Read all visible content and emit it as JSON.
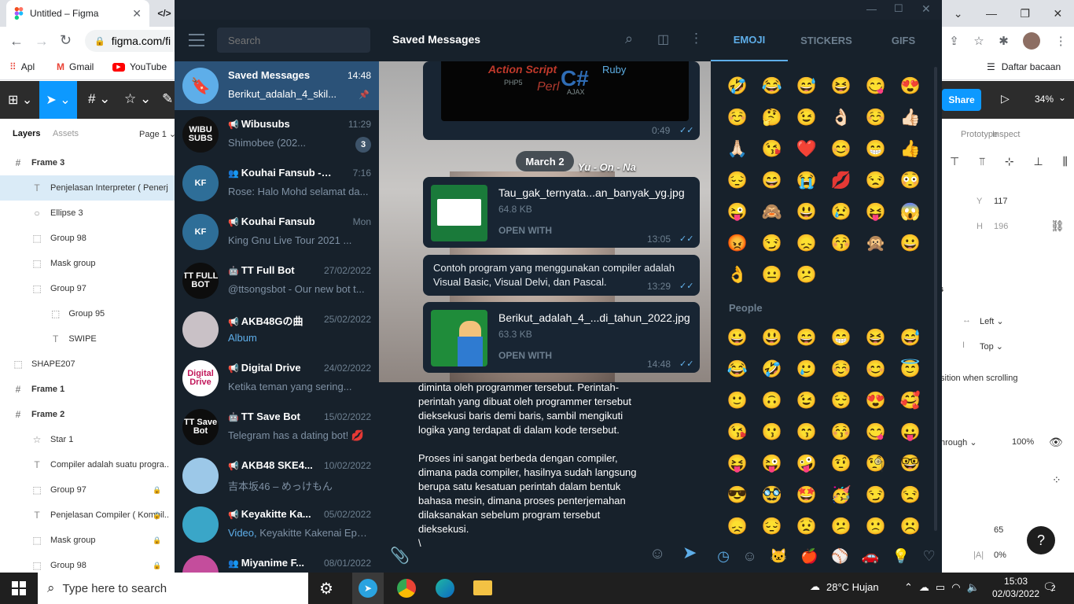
{
  "chrome": {
    "tab_title": "Untitled – Figma",
    "url": "figma.com/fi",
    "bookmarks": [
      "Apl",
      "Gmail",
      "YouTube"
    ],
    "reading_list": "Daftar bacaan"
  },
  "figma": {
    "layers_tab": "Layers",
    "assets_tab": "Assets",
    "page": "Page 1",
    "layers": [
      {
        "icon": "#",
        "name": "Frame 3",
        "indent": 0,
        "frame": true
      },
      {
        "icon": "T",
        "name": "Penjelasan Interpreter ( Penerj",
        "indent": 1,
        "selected": true
      },
      {
        "icon": "○",
        "name": "Ellipse 3",
        "indent": 1
      },
      {
        "icon": "⬚",
        "name": "Group 98",
        "indent": 1
      },
      {
        "icon": "⬚",
        "name": "Mask group",
        "indent": 1
      },
      {
        "icon": "⬚",
        "name": "Group 97",
        "indent": 1
      },
      {
        "icon": "⬚",
        "name": "Group 95",
        "indent": 2
      },
      {
        "icon": "T",
        "name": "SWIPE",
        "indent": 2
      },
      {
        "icon": "⬚",
        "name": "SHAPE207",
        "indent": 0
      },
      {
        "icon": "#",
        "name": "Frame 1",
        "indent": 0,
        "frame": true
      },
      {
        "icon": "#",
        "name": "Frame 2",
        "indent": 0,
        "frame": true
      },
      {
        "icon": "☆",
        "name": "Star 1",
        "indent": 1
      },
      {
        "icon": "T",
        "name": "Compiler adalah suatu progra...",
        "indent": 1
      },
      {
        "icon": "⬚",
        "name": "Group 97",
        "indent": 1,
        "locked": true
      },
      {
        "icon": "T",
        "name": "Penjelasan Compiler ( Kompil...",
        "indent": 1,
        "locked": true
      },
      {
        "icon": "⬚",
        "name": "Mask group",
        "indent": 1,
        "locked": true
      },
      {
        "icon": "⬚",
        "name": "Group 98",
        "indent": 1,
        "locked": true
      }
    ],
    "share": "Share",
    "zoom": "34%",
    "prototype_tab": "Prototype",
    "inspect_tab": "Inspect",
    "y_label": "Y",
    "y_value": "117",
    "h_label": "H",
    "h_value": "196",
    "constraint_h": "Left",
    "constraint_v": "Top",
    "scroll_text": "sition when scrolling",
    "section_s": "s",
    "blend": "hrough",
    "opacity": "100%",
    "font_size": "65",
    "letter_spacing": "0%"
  },
  "telegram": {
    "search_placeholder": "Search",
    "header_title": "Saved Messages",
    "chats": [
      {
        "name": "Saved Messages",
        "time": "14:48",
        "preview": "Berikut_adalah_4_skil...",
        "active": true,
        "pinned": true,
        "avatar_color": "#5eaee9",
        "avatar_text": ""
      },
      {
        "name": "Wibusubs",
        "time": "11:29",
        "preview": "Shimobee (202...",
        "badge": "3",
        "avatar_color": "#111",
        "avatar_text": "WIBU SUBS",
        "channel": true
      },
      {
        "name": "Kouhai Fansub - Gr...",
        "time": "7:16",
        "preview": "Rose: Halo Mohd selamat da...",
        "avatar_color": "#2e6e98",
        "avatar_text": "KF",
        "group": true
      },
      {
        "name": "Kouhai Fansub",
        "time": "Mon",
        "preview": "King Gnu Live Tour 2021 ...",
        "avatar_color": "#2e6e98",
        "avatar_text": "KF",
        "channel": true
      },
      {
        "name": "TT Full Bot",
        "time": "27/02/2022",
        "preview": "@ttsongsbot - Our new bot t...",
        "avatar_color": "#0d0d0d",
        "avatar_text": "TT FULL BOT",
        "bot": true
      },
      {
        "name": "AKB48Gの曲",
        "time": "25/02/2022",
        "preview": "Album",
        "avatar_color": "#c9c1c6",
        "avatar_text": "",
        "channel": true,
        "preview_accent": true
      },
      {
        "name": "Digital Drive",
        "time": "24/02/2022",
        "preview": "Ketika teman yang sering...",
        "avatar_color": "#ffffff",
        "avatar_text": "Digital Drive",
        "channel": true
      },
      {
        "name": "TT Save Bot",
        "time": "15/02/2022",
        "preview": "Telegram has a dating bot! 💋",
        "avatar_color": "#0d0d0d",
        "avatar_text": "TT Save Bot",
        "bot": true
      },
      {
        "name": "AKB48 SKE4...",
        "time": "10/02/2022",
        "preview": "吉本坂46 – めっけもん",
        "avatar_color": "#9cc8e8",
        "avatar_text": "",
        "channel": true
      },
      {
        "name": "Keyakitte Ka...",
        "time": "05/02/2022",
        "preview_prefix": "Video,",
        "preview": " Keyakitte Kakenai Eps ...",
        "avatar_color": "#3aa6c8",
        "avatar_text": "",
        "channel": true
      },
      {
        "name": "Miyanime F...",
        "time": "08/01/2022",
        "preview": "",
        "avatar_color": "#c44d9c",
        "avatar_text": "",
        "group": true
      }
    ],
    "date_badge": "March 2",
    "msg_video_time": "0:49",
    "file1": {
      "name": "Tau_gak_ternyata...an_banyak_yg.jpg",
      "size": "64.8 KB",
      "action": "OPEN WITH",
      "time": "13:05"
    },
    "text_msg": {
      "text": "Contoh program yang menggunakan compiler adalah Visual Basic, Visual Delvi, dan Pascal.",
      "time": "13:29"
    },
    "file2": {
      "name": "Berikut_adalah_4_...di_tahun_2022.jpg",
      "size": "63.3 KB",
      "action": "OPEN WITH",
      "time": "14:48"
    },
    "overlay_caption": "Yu - On - Na",
    "compose_text": "diminta oleh programmer tersebut. Perintah-perintah yang dibuat oleh programmer tersebut dieksekusi baris demi baris, sambil mengikuti logika yang terdapat di dalam kode tersebut.\n\nProses ini sangat berbeda dengan compiler, dimana pada compiler, hasilnya sudah langsung berupa satu kesatuan perintah dalam bentuk bahasa mesin, dimana proses penterjemahan dilaksanakan sebelum program tersebut dieksekusi.\n\\",
    "emoji_tabs": [
      "EMOJI",
      "STICKERS",
      "GIFS"
    ],
    "people_label": "People",
    "recent_emoji": [
      "🤣",
      "😂",
      "😅",
      "😆",
      "😋",
      "😍",
      "☺️",
      "🤔",
      "😉",
      "👌🏻",
      "☺️",
      "👍🏻",
      "🙏🏻",
      "😘",
      "❤️",
      "😊",
      "😁",
      "👍",
      "😔",
      "😄",
      "😭",
      "💋",
      "😒",
      "😳",
      "😜",
      "🙈",
      "😃",
      "😢",
      "😝",
      "😱",
      "😡",
      "😏",
      "😞",
      "😚",
      "🙊",
      "😀",
      "👌",
      "😐",
      "😕"
    ],
    "people_emoji": [
      "😀",
      "😃",
      "😄",
      "😁",
      "😆",
      "😅",
      "😂",
      "🤣",
      "🥲",
      "☺️",
      "😊",
      "😇",
      "🙂",
      "🙃",
      "😉",
      "😌",
      "😍",
      "🥰",
      "😘",
      "😗",
      "😙",
      "😚",
      "😋",
      "😛",
      "😝",
      "😜",
      "🤪",
      "🤨",
      "🧐",
      "🤓",
      "😎",
      "🥸",
      "🤩",
      "🥳",
      "😏",
      "😒",
      "😞",
      "😔",
      "😟",
      "😕",
      "🙁",
      "☹️"
    ]
  },
  "taskbar": {
    "search_placeholder": "Type here to search",
    "weather": "28°C  Hujan",
    "time": "15:03",
    "date": "02/03/2022",
    "notifications": "2"
  },
  "colors": {
    "figma_accent": "#0d99ff",
    "tg_active": "#2b5278",
    "tg_tab_accent": "#5eaee9"
  }
}
